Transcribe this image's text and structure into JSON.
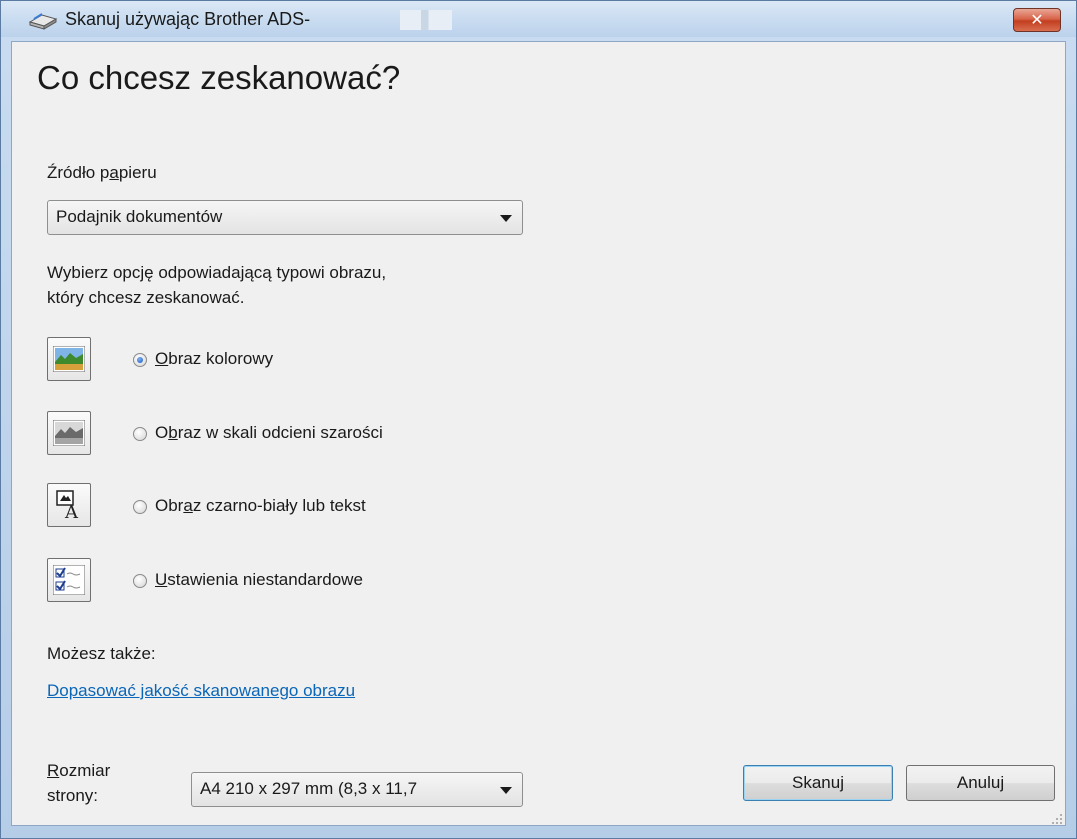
{
  "window": {
    "title": "Skanuj używając Brother ADS-",
    "close_label": "✕"
  },
  "main": {
    "heading": "Co chcesz zeskanować?",
    "paper_source": {
      "label_pre": "Źródło p",
      "label_underlined": "a",
      "label_post": "pieru",
      "value": "Podajnik dokumentów"
    },
    "instruction_line1": "Wybierz opcję odpowiadającą typowi obrazu,",
    "instruction_line2": "który chcesz zeskanować.",
    "options": [
      {
        "pre": "",
        "underlined": "O",
        "post": "braz kolorowy",
        "checked": true,
        "icon": "color-picture-icon"
      },
      {
        "pre": "O",
        "underlined": "b",
        "post": "raz w skali odcieni szarości",
        "checked": false,
        "icon": "grayscale-picture-icon"
      },
      {
        "pre": "Obr",
        "underlined": "a",
        "post": "z czarno-biały lub tekst",
        "checked": false,
        "icon": "black-white-text-icon"
      },
      {
        "pre": "",
        "underlined": "U",
        "post": "stawienia niestandardowe",
        "checked": false,
        "icon": "custom-settings-icon"
      }
    ],
    "also_label": "Możesz także:",
    "adjust_link": "Dopasować jakość skanowanego obrazu"
  },
  "footer": {
    "page_size_label_line1_underlined": "R",
    "page_size_label_line1_rest": "ozmiar",
    "page_size_label_line2": "strony:",
    "page_size_value": "A4 210 x 297 mm (8,3 x 11,7",
    "scan_button": "Skanuj",
    "cancel_button": "Anuluj"
  }
}
